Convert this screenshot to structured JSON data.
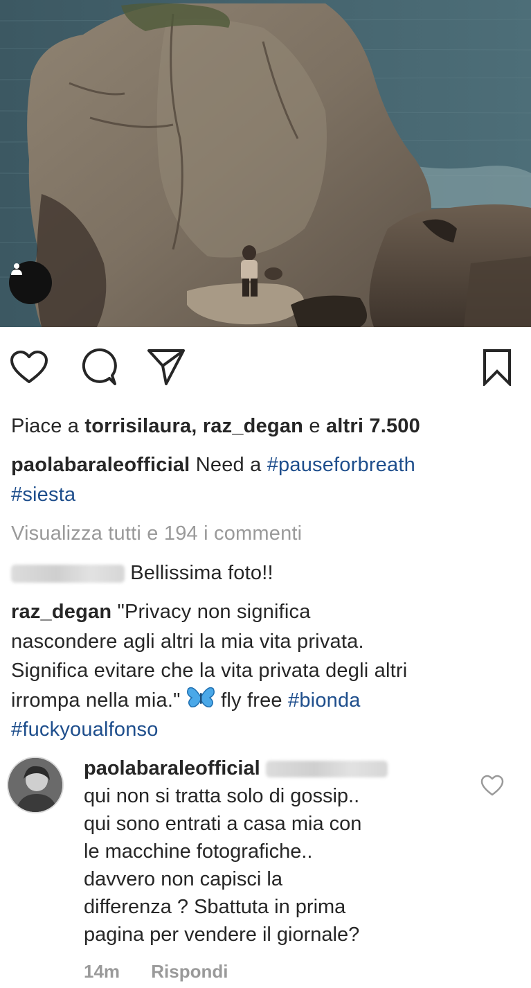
{
  "post": {
    "author": "paolabaraleofficial",
    "caption": "Need a",
    "hashtags": [
      "#pauseforbreath",
      "#siesta"
    ],
    "likes": {
      "prefix": "Piace a",
      "users": "torrisilaura, raz_degan",
      "connector": "e",
      "others": "altri 7.500"
    },
    "view_comments": "Visualizza tutti e 194 i commenti"
  },
  "icons": {
    "like": "heart-icon",
    "comment": "comment-icon",
    "share": "send-icon",
    "save": "bookmark-icon",
    "user_tag": "user-tag-icon"
  },
  "comments": [
    {
      "author_hidden": true,
      "text": "Bellissima foto!!"
    },
    {
      "author": "raz_degan",
      "lines": [
        "\"Privacy non significa",
        "nascondere agli altri la mia vita privata.",
        "Significa evitare che la vita privata degli altri",
        "irrompa nella mia.\""
      ],
      "emoji": "butterfly",
      "after_emoji": "fly free",
      "hashtags": [
        "#bionda",
        "#fuckyoualfonso"
      ]
    }
  ],
  "reply": {
    "author": "paolabaraleofficial",
    "lines": [
      "qui non si tratta solo di gossip..",
      "qui sono entrati a casa mia con",
      "le macchine fotografiche..",
      "davvero non capisci la",
      "differenza ?  Sbattuta in prima",
      "pagina per vendere il giornale?"
    ],
    "time": "14m",
    "reply_label": "Rispondi"
  },
  "colors": {
    "hashtag": "#1e4e8c",
    "muted": "#9a9a9a",
    "text": "#262626"
  }
}
